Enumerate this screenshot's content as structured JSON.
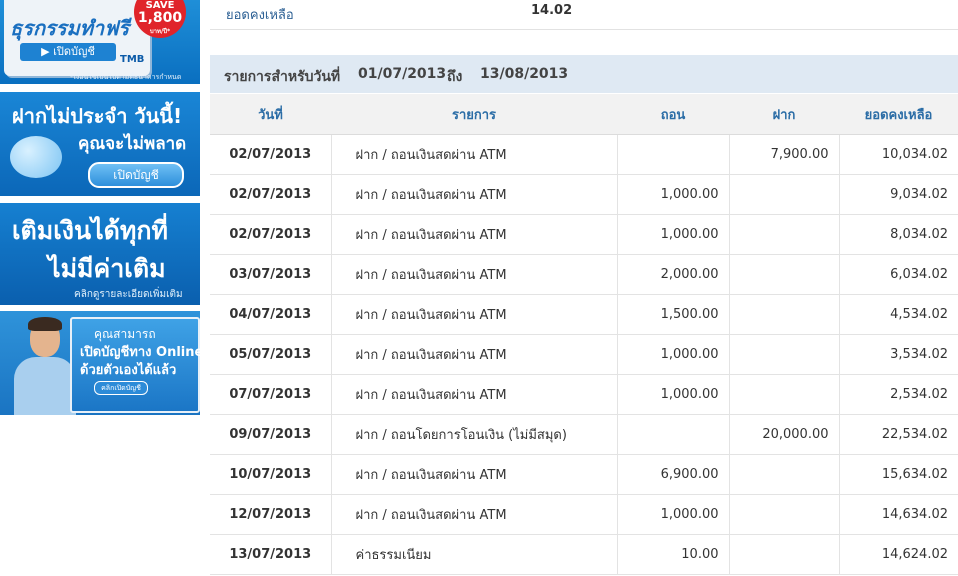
{
  "sidebar": {
    "banner1": {
      "headline": "ธุรกรรมทำฟรี",
      "badge_save": "SAVE",
      "badge_amount": "1,800",
      "badge_unit": "บาท/ปี*",
      "button": "เปิดบัญชี",
      "brand": "TMB",
      "note": "*เงื่อนไขเป็นไปตามที่ธนาคารกำหนด"
    },
    "banner2": {
      "line1": "ฝากไม่ประจำ วันนี้!",
      "line2": "คุณจะไม่พลาด",
      "button": "เปิดบัญชี"
    },
    "banner3": {
      "line1": "เติมเงินได้ทุกที่",
      "line2": "ไม่มีค่าเติม",
      "line3": "คลิกดูรายละเอียดเพิ่มเติม"
    },
    "banner4": {
      "line1": "คุณสามารถ",
      "line2": "เปิดบัญชีทาง Online",
      "line3": "ด้วยตัวเองได้แล้ว",
      "button": "คลิกเปิดบัญชี"
    }
  },
  "balance": {
    "label": "ยอดคงเหลือ",
    "value": "14.02"
  },
  "period": {
    "prefix": "รายการสำหรับวันที่",
    "from": "01/07/2013",
    "to_label": "ถึง",
    "to": "13/08/2013"
  },
  "table": {
    "headers": {
      "date": "วันที่",
      "desc": "รายการ",
      "withdraw": "ถอน",
      "deposit": "ฝาก",
      "balance": "ยอดคงเหลือ"
    },
    "rows": [
      {
        "date": "02/07/2013",
        "desc": "ฝาก / ถอนเงินสดผ่าน ATM",
        "withdraw": "",
        "deposit": "7,900.00",
        "balance": "10,034.02"
      },
      {
        "date": "02/07/2013",
        "desc": "ฝาก / ถอนเงินสดผ่าน ATM",
        "withdraw": "1,000.00",
        "deposit": "",
        "balance": "9,034.02"
      },
      {
        "date": "02/07/2013",
        "desc": "ฝาก / ถอนเงินสดผ่าน ATM",
        "withdraw": "1,000.00",
        "deposit": "",
        "balance": "8,034.02"
      },
      {
        "date": "03/07/2013",
        "desc": "ฝาก / ถอนเงินสดผ่าน ATM",
        "withdraw": "2,000.00",
        "deposit": "",
        "balance": "6,034.02"
      },
      {
        "date": "04/07/2013",
        "desc": "ฝาก / ถอนเงินสดผ่าน ATM",
        "withdraw": "1,500.00",
        "deposit": "",
        "balance": "4,534.02"
      },
      {
        "date": "05/07/2013",
        "desc": "ฝาก / ถอนเงินสดผ่าน ATM",
        "withdraw": "1,000.00",
        "deposit": "",
        "balance": "3,534.02"
      },
      {
        "date": "07/07/2013",
        "desc": "ฝาก / ถอนเงินสดผ่าน ATM",
        "withdraw": "1,000.00",
        "deposit": "",
        "balance": "2,534.02"
      },
      {
        "date": "09/07/2013",
        "desc": "ฝาก / ถอนโดยการโอนเงิน (ไม่มีสมุด)",
        "withdraw": "",
        "deposit": "20,000.00",
        "balance": "22,534.02"
      },
      {
        "date": "10/07/2013",
        "desc": "ฝาก / ถอนเงินสดผ่าน ATM",
        "withdraw": "6,900.00",
        "deposit": "",
        "balance": "15,634.02"
      },
      {
        "date": "12/07/2013",
        "desc": "ฝาก / ถอนเงินสดผ่าน ATM",
        "withdraw": "1,000.00",
        "deposit": "",
        "balance": "14,634.02"
      },
      {
        "date": "13/07/2013",
        "desc": "ค่าธรรมเนียม",
        "withdraw": "10.00",
        "deposit": "",
        "balance": "14,624.02"
      }
    ]
  }
}
